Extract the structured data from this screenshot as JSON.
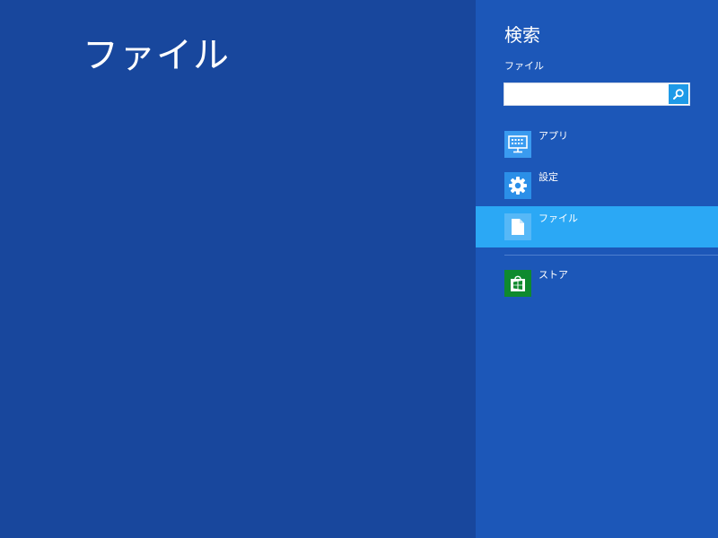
{
  "main": {
    "title": "ファイル"
  },
  "charm": {
    "title": "検索",
    "scope": "ファイル",
    "search": {
      "value": "",
      "placeholder": ""
    },
    "items": [
      {
        "label": "アプリ",
        "icon": "apps-icon",
        "color": "#3a9bf0",
        "selected": false
      },
      {
        "label": "設定",
        "icon": "settings-gear-icon",
        "color": "#2b8fe8",
        "selected": false
      },
      {
        "label": "ファイル",
        "icon": "file-icon",
        "color": "#56b8f7",
        "selected": true
      },
      {
        "label": "ストア",
        "icon": "store-icon",
        "color": "#0f8a2e",
        "selected": false
      }
    ]
  },
  "colors": {
    "background": "#18479d",
    "charm_background": "#1c57b8",
    "selected": "#2ba8f5",
    "search_button": "#1e9ae8"
  }
}
